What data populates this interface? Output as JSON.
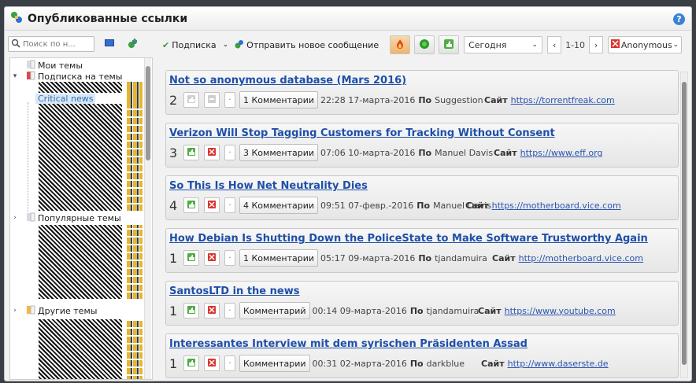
{
  "window": {
    "title": "Опубликованные ссылки",
    "help": "?"
  },
  "left": {
    "search_placeholder": "Поиск по н...",
    "tree": {
      "my_topics": "Мои темы",
      "subscribed": "Подписка на темы",
      "selected_item": "Critical news",
      "popular": "Популярные темы",
      "other": "Другие темы"
    }
  },
  "toolbar": {
    "subscribe": "Подписка",
    "post_new": "Отправить новое сообщение",
    "period": "Сегодня",
    "pager_text": "1-10",
    "prev": "‹",
    "next": "›",
    "user": "Anonymous"
  },
  "labels": {
    "by": "По",
    "site": "Сайт"
  },
  "posts": [
    {
      "title": "Not so anonymous database (Mars 2016)",
      "votes": "2",
      "comments": "1 Комментарии",
      "date": "22:28 17-марта-2016",
      "author": "Suggestion",
      "site": "https://torrentfreak.com"
    },
    {
      "title": "Verizon Will Stop Tagging Customers for Tracking Without Consent",
      "votes": "3",
      "comments": "3 Комментарии",
      "date": "07:06 10-марта-2016",
      "author": "Manuel Davis",
      "site": "https://www.eff.org"
    },
    {
      "title": "So This Is How Net Neutrality Dies",
      "votes": "4",
      "comments": "4 Комментарии",
      "date": "09:51 07-февр.-2016",
      "author": "Manuel Davis",
      "site": "https://motherboard.vice.com"
    },
    {
      "title": "How Debian Is Shutting Down the PoliceState to Make Software Trustworthy Again",
      "votes": "1",
      "comments": "1 Комментарии",
      "date": "05:17 09-марта-2016",
      "author": "tjandamuira",
      "site": "http://motherboard.vice.com"
    },
    {
      "title": "SantosLTD in the news",
      "votes": "1",
      "comments": "Комментарий",
      "date": "00:14 09-марта-2016",
      "author": "tjandamuira",
      "site": "https://www.youtube.com"
    },
    {
      "title": "Interessantes Interview mit dem syrischen Präsidenten Assad",
      "votes": "1",
      "comments": "Комментарии",
      "date": "00:31 02-марта-2016",
      "author": "darkblue",
      "site": "http://www.daserste.de"
    }
  ],
  "colors": {
    "link": "#1f4fa8",
    "accent": "#3b82d6",
    "upvote": "#4caf3f",
    "downvote": "#d9342b"
  }
}
